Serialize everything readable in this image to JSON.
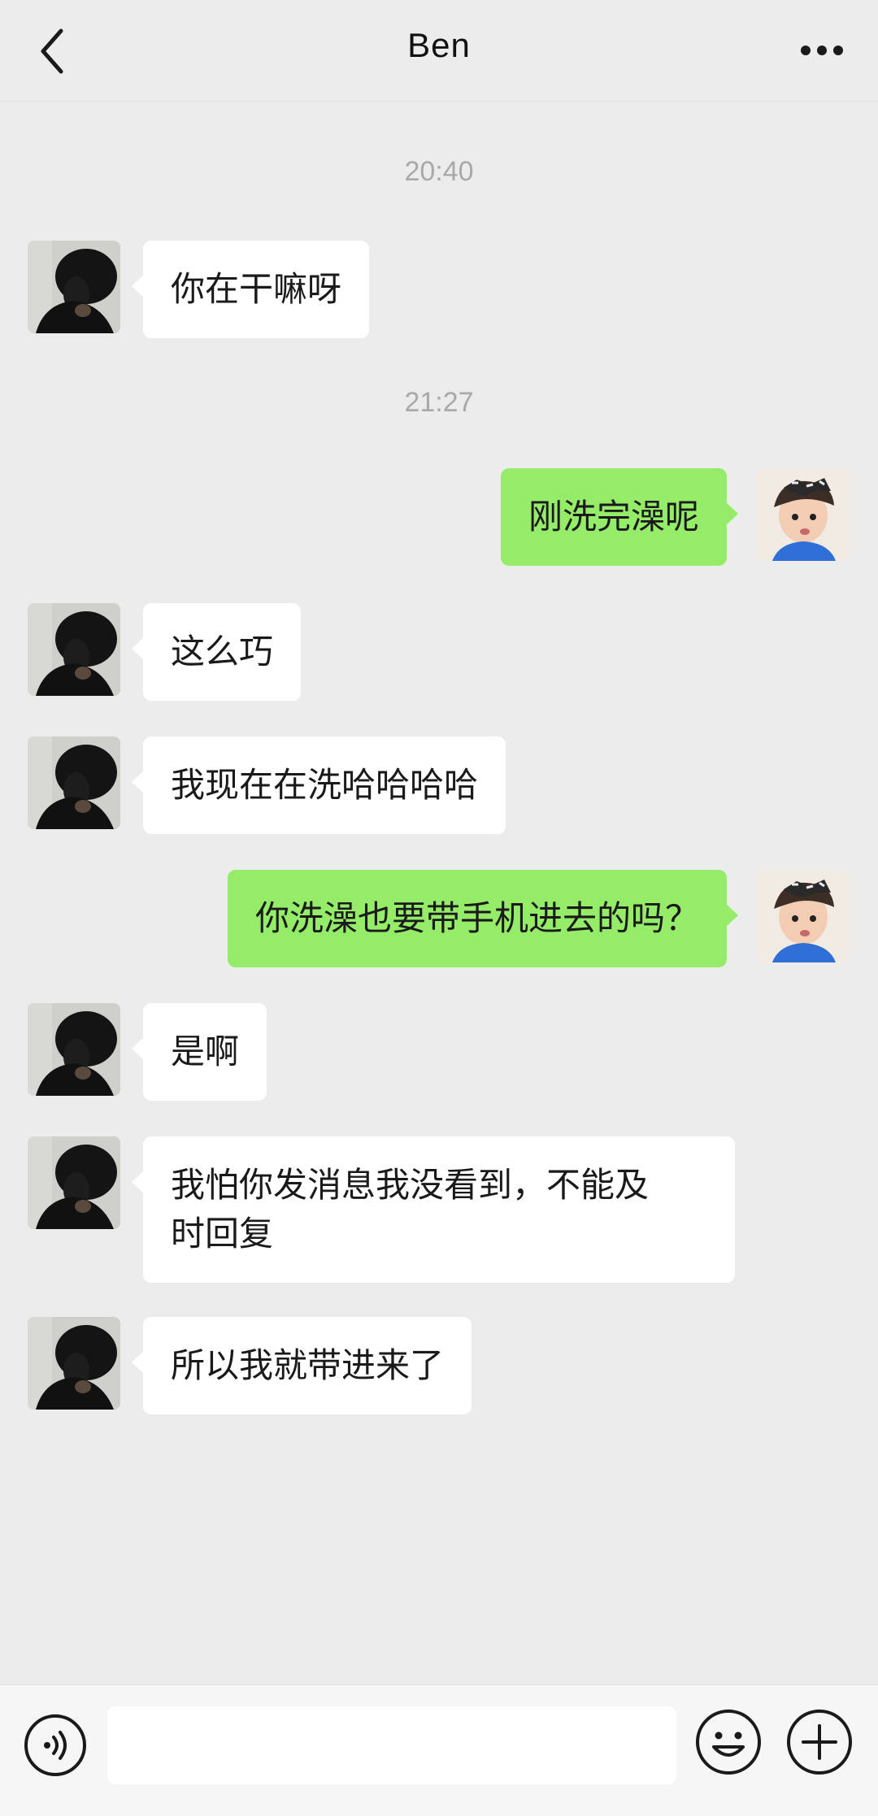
{
  "header": {
    "title": "Ben",
    "back_icon": "chevron-left-icon",
    "more_icon": "more-dots-icon"
  },
  "messages": [
    {
      "type": "time",
      "text": "20:40"
    },
    {
      "type": "in",
      "sender": "Ben",
      "text": "你在干嘛呀"
    },
    {
      "type": "time",
      "text": "21:27"
    },
    {
      "type": "out",
      "text": "刚洗完澡呢"
    },
    {
      "type": "in",
      "sender": "Ben",
      "text": "这么巧"
    },
    {
      "type": "in",
      "sender": "Ben",
      "text": "我现在在洗哈哈哈哈"
    },
    {
      "type": "out",
      "text": "你洗澡也要带手机进去的吗？"
    },
    {
      "type": "in",
      "sender": "Ben",
      "text": "是啊"
    },
    {
      "type": "in",
      "sender": "Ben",
      "text": "我怕你发消息我没看到，不能及\n时回复"
    },
    {
      "type": "in",
      "sender": "Ben",
      "text": "所以我就带进来了"
    }
  ],
  "input_bar": {
    "voice_icon": "voice-icon",
    "emoji_icon": "emoji-icon",
    "plus_icon": "plus-icon",
    "input_value": ""
  },
  "colors": {
    "background": "#ececec",
    "bubble_incoming": "#ffffff",
    "bubble_outgoing": "#95ec69",
    "timestamp": "#a9a9a9"
  }
}
